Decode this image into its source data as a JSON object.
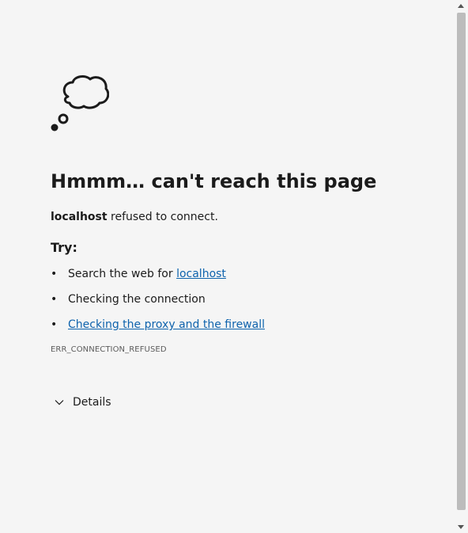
{
  "title": "Hmmm… can't reach this page",
  "message": {
    "host": "localhost",
    "text": " refused to connect."
  },
  "try_heading": "Try:",
  "suggestions": [
    {
      "bullet": "•",
      "prefix": "Search the web for ",
      "link": "localhost"
    },
    {
      "bullet": "•",
      "text": "Checking the connection"
    },
    {
      "bullet": "•",
      "link": "Checking the proxy and the firewall"
    }
  ],
  "error_code": "ERR_CONNECTION_REFUSED",
  "details_label": "Details",
  "icons": {
    "illustration": "thought-bubble-icon",
    "details_toggle": "chevron-down-icon"
  },
  "colors": {
    "background": "#f5f5f5",
    "text": "#1b1b1b",
    "link": "#0e63ad",
    "error_code": "#5c5c5c",
    "scrollbar_thumb": "#bcbcbc"
  }
}
